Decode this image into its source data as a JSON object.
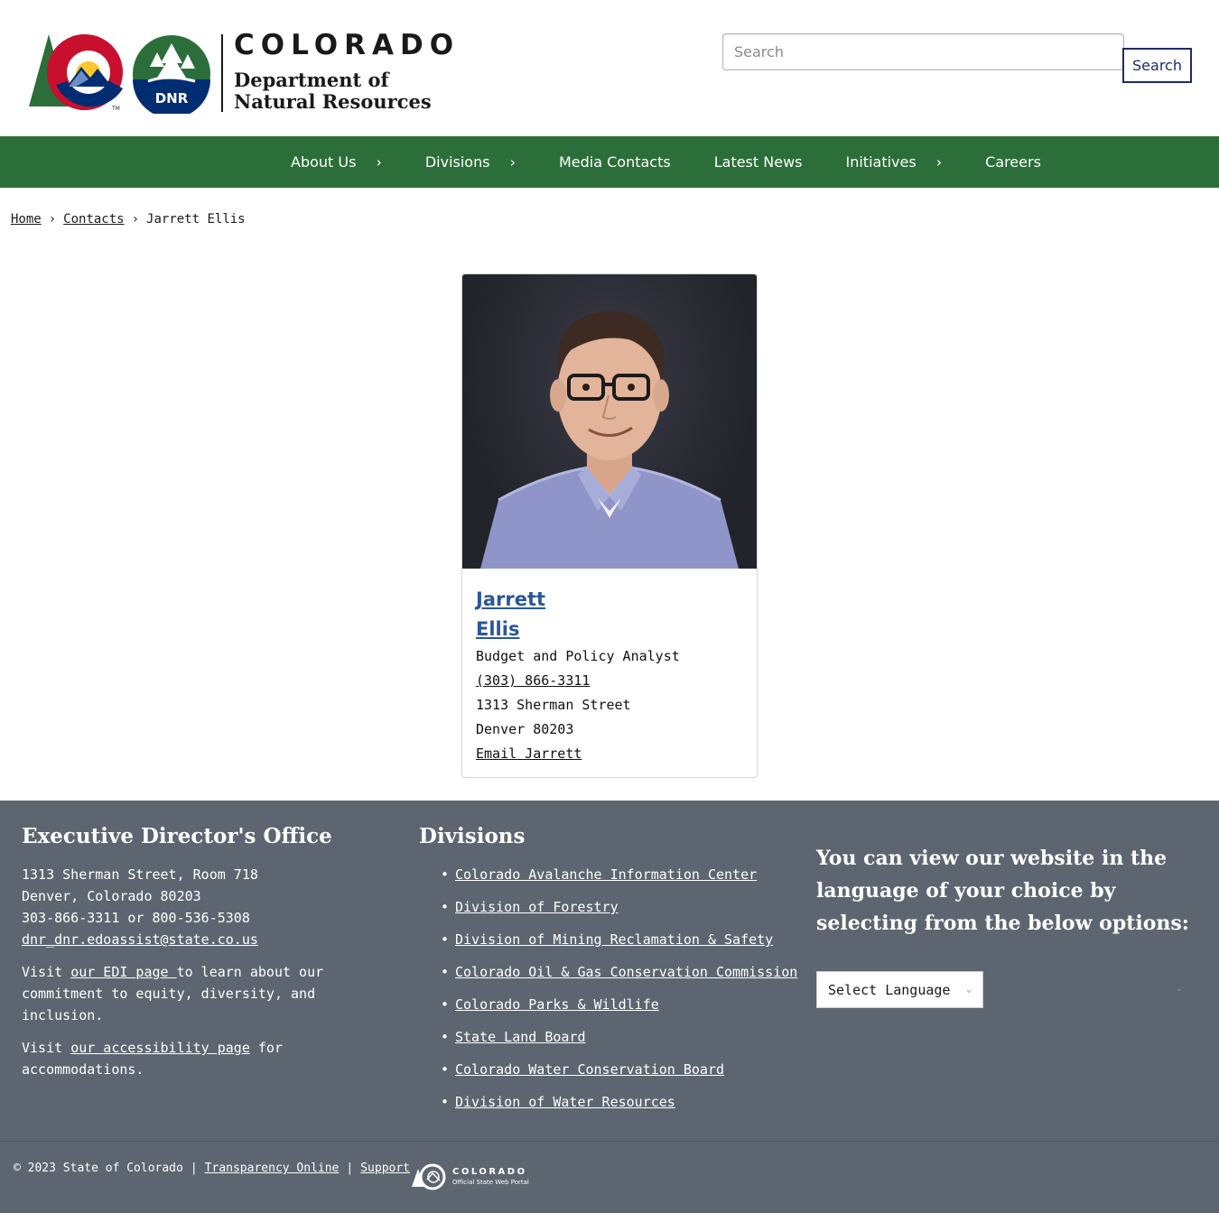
{
  "header": {
    "logo_state": "COLORADO",
    "logo_dept_line1": "Department of",
    "logo_dept_line2": "Natural Resources",
    "logo_badge": "DNR",
    "logo_tm": "TM",
    "search_placeholder": "Search",
    "search_button": "Search"
  },
  "nav": {
    "items": [
      {
        "label": "About Us",
        "has_submenu": true
      },
      {
        "label": "Divisions",
        "has_submenu": true
      },
      {
        "label": "Media Contacts",
        "has_submenu": false
      },
      {
        "label": "Latest News",
        "has_submenu": false
      },
      {
        "label": "Initiatives",
        "has_submenu": true
      },
      {
        "label": "Careers",
        "has_submenu": false
      }
    ],
    "chevron": "›",
    "color": "#2c6e3a"
  },
  "breadcrumb": {
    "home": "Home",
    "contacts": "Contacts",
    "current": "Jarrett Ellis",
    "separator": "›"
  },
  "contact": {
    "first_name": "Jarrett",
    "last_name": "Ellis",
    "title": "Budget and Policy Analyst",
    "phone": "(303) 866-3311",
    "street": "1313 Sherman Street",
    "city_zip": "Denver 80203",
    "email_label": "Email Jarrett",
    "name_color": "#2b5797"
  },
  "footer": {
    "office": {
      "heading": "Executive Director's Office",
      "address_line1": "1313 Sherman Street, Room 718",
      "address_line2": "Denver, Colorado 80203",
      "phones": "303-866-3311 or 800-536-5308",
      "email": "dnr_dnr.edoassist@state.co.us",
      "edi_prefix": "Visit ",
      "edi_link": "our EDI page ",
      "edi_suffix": "to learn about our commitment to equity, diversity, and inclusion.",
      "access_prefix": "Visit ",
      "access_link": "our accessibility page",
      "access_suffix": " for accommodations."
    },
    "divisions": {
      "heading": "Divisions",
      "items": [
        "Colorado Avalanche Information Center",
        "Division of Forestry",
        "Division of Mining Reclamation & Safety",
        "Colorado Oil & Gas Conservation Commission",
        "Colorado Parks & Wildlife",
        "State Land Board",
        "Colorado Water Conservation Board",
        "Division of Water Resources"
      ]
    },
    "language": {
      "heading": "You can view our website in the language of your choice by selecting from the below options:",
      "select_label": "Select Language"
    },
    "background_color": "#5d6670"
  },
  "bottom": {
    "copyright": "© 2023 State of Colorado",
    "pipe": "|",
    "transparency": "Transparency Online",
    "support": "Support",
    "portal_title": "COLORADO",
    "portal_sub": "Official State Web Portal"
  }
}
